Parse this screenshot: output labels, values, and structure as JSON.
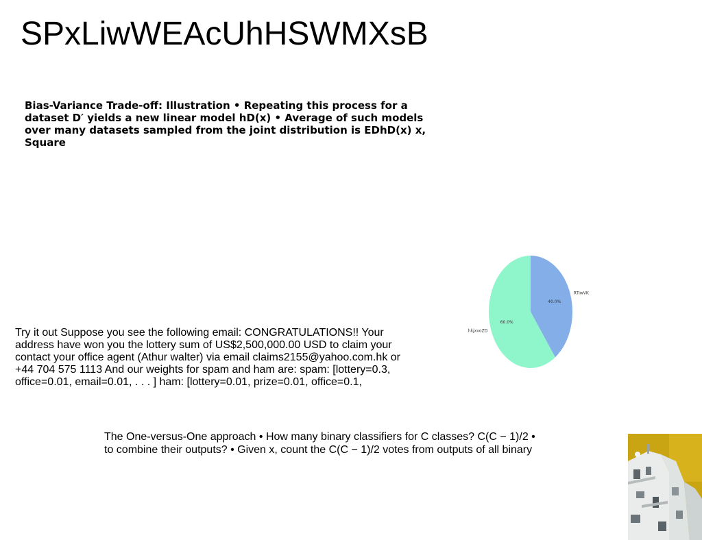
{
  "slide": {
    "title": "SPxLiwWEAcUhHSWMXsB",
    "bias_variance_text": "Bias-Variance Trade-off: Illustration • Repeating this process for a dataset D′ yields a new linear model hD(x) • Average of such models over many datasets sampled from the joint distribution is EDhD(x) x, Square",
    "email_text": "Try it out Suppose you see the following email: CONGRATULATIONS!! Your address have won you the lottery sum of US$2,500,000.00 USD to claim your contact your office agent (Athur walter) via email claims2155@yahoo.com.hk or +44 704 575 1113 And our weights for spam and ham are: spam: [lottery=0.3, office=0.01, email=0.01, . . . ] ham: [lottery=0.01, prize=0.01, office=0.1,",
    "ovo_text": "The One-versus-One approach • How many binary classifiers for C classes? C(C − 1)/2 • to combine their outputs? • Given x, count the C(C − 1)/2 votes from outputs of all binary"
  },
  "chart_data": {
    "type": "pie",
    "slices": [
      {
        "label": "RTIwVK",
        "value": 40.0,
        "pct_label": "40.0%",
        "color": "#84aee8"
      },
      {
        "label": "hkjxvoZD",
        "value": 60.0,
        "pct_label": "60.0%",
        "color": "#8ff5cb"
      }
    ],
    "start_angle_deg": 90,
    "direction": "clockwise"
  }
}
